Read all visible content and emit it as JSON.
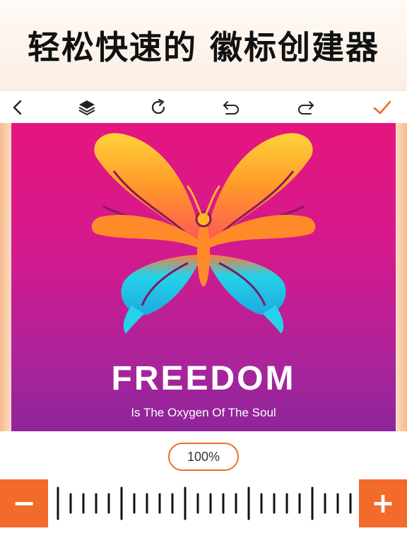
{
  "headline": {
    "text": "轻松快速的 徽标创建器"
  },
  "toolbar": {
    "icons": [
      "chevron-left-icon",
      "layers-icon",
      "rotate-icon",
      "undo-icon",
      "redo-icon",
      "checkmark-icon"
    ],
    "accent": "#f26b2a"
  },
  "artboard": {
    "title": "FREEDOM",
    "subtitle": "Is The Oxygen Of The Soul",
    "gradient_top": "#e5157f",
    "gradient_bottom": "#8e259a"
  },
  "zoom": {
    "label": "100%",
    "value_percent": 100
  },
  "controls": {
    "minus_label": "−",
    "plus_label": "+"
  }
}
